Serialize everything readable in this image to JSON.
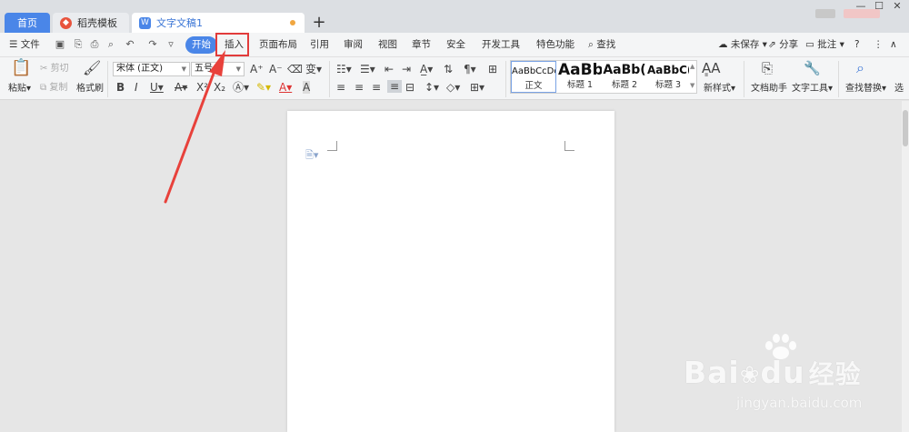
{
  "tabs": {
    "home": "首页",
    "template": "稻壳模板",
    "document": "文字文稿1",
    "new_tab": "+"
  },
  "window": {
    "minimize": "—",
    "maximize": "☐",
    "close": "✕"
  },
  "menu": {
    "file": "文件",
    "items": [
      "开始",
      "插入",
      "页面布局",
      "引用",
      "审阅",
      "视图",
      "章节",
      "安全",
      "开发工具",
      "特色功能",
      "查找"
    ],
    "right": {
      "unsaved": "未保存",
      "share": "分享",
      "annotate": "批注",
      "help": "?",
      "more": "⋮",
      "collapse": "∧"
    }
  },
  "ribbon": {
    "paste": "粘贴",
    "cut": "剪切",
    "copy": "复制",
    "format_painter": "格式刷",
    "font_name": "宋体 (正文)",
    "font_size": "五号",
    "styles": [
      {
        "preview": "AaBbCcDd",
        "label": "正文"
      },
      {
        "preview": "AaBb",
        "label": "标题 1"
      },
      {
        "preview": "AaBb(",
        "label": "标题 2"
      },
      {
        "preview": "AaBbC(",
        "label": "标题 3"
      }
    ],
    "new_style": "新样式",
    "doc_assistant": "文档助手",
    "text_tools": "文字工具",
    "find_replace": "查找替换",
    "select": "选"
  },
  "watermark": {
    "brand": "Bai",
    "brand2": "du",
    "brand_cn": "经验",
    "url": "jingyan.baidu.com"
  },
  "colors": {
    "accent": "#4a86e8",
    "highlight_box": "#e23b3b",
    "arrow": "#e8413b",
    "unsaved_dot": "#f0a640"
  }
}
